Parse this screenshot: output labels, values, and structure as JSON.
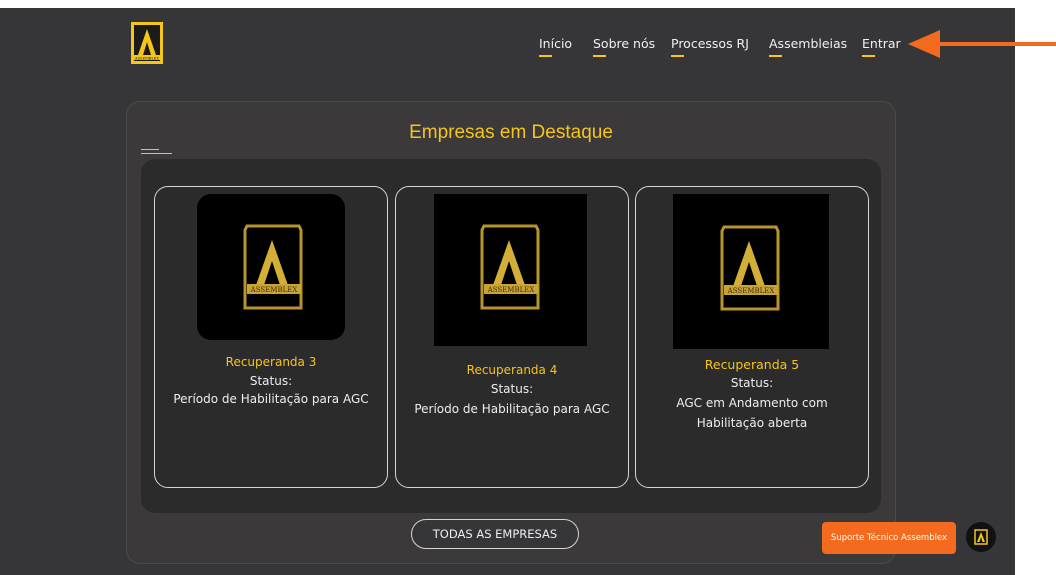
{
  "nav": {
    "items": [
      {
        "label": "Início"
      },
      {
        "label": "Sobre nós"
      },
      {
        "label": "Processos RJ"
      },
      {
        "label": "Assembleias"
      },
      {
        "label": "Entrar"
      }
    ]
  },
  "brand": {
    "logo_text": "ASSEMBLEX"
  },
  "featured": {
    "title": "Empresas em Destaque",
    "cards": [
      {
        "name": "Recuperanda 3",
        "status_label": "Status:",
        "status_text": [
          "Período de Habilitação para AGC"
        ]
      },
      {
        "name": "Recuperanda 4",
        "status_label": "Status:",
        "status_text": [
          "Período de Habilitação para AGC"
        ]
      },
      {
        "name": "Recuperanda 5",
        "status_label": "Status:",
        "status_text": [
          "AGC em Andamento com",
          "Habilitação aberta"
        ]
      }
    ],
    "all_button": "TODAS AS EMPRESAS"
  },
  "support": {
    "label": "Suporte Técnico Assemblex"
  },
  "colors": {
    "accent": "#f5c518",
    "background": "#363538",
    "support": "#f46a1e",
    "arrow": "#f46a1e"
  }
}
